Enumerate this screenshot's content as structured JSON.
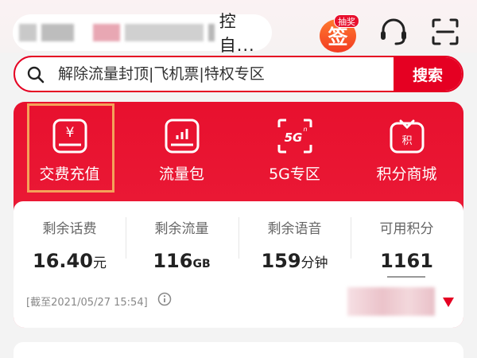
{
  "header": {
    "user_pill_text": "控自...",
    "sign_label": "签",
    "sign_tag": "抽奖",
    "icons": [
      "customer-service-icon",
      "scan-icon"
    ]
  },
  "search": {
    "placeholder": "解除流量封顶|飞机票|特权专区",
    "button_label": "搜索"
  },
  "quick_actions": [
    {
      "label": "交费充值",
      "icon": "yuan-payment-icon",
      "focused": true
    },
    {
      "label": "流量包",
      "icon": "data-package-icon",
      "focused": false
    },
    {
      "label": "5G专区",
      "icon": "5g-icon",
      "focused": false
    },
    {
      "label": "积分商城",
      "icon": "points-mall-icon",
      "focused": false
    }
  ],
  "balance": {
    "items": [
      {
        "label": "剩余话费",
        "value": "16.40",
        "unit": "元"
      },
      {
        "label": "剩余流量",
        "value": "116",
        "unit": "GB"
      },
      {
        "label": "剩余语音",
        "value": "159",
        "unit": "分钟"
      },
      {
        "label": "可用积分",
        "value": "1161",
        "unit": ""
      }
    ],
    "timestamp": "[截至2021/05/27 15:54]"
  },
  "colors": {
    "brand_red": "#e50022",
    "focus_outline": "#f4a25a",
    "sign_orange": "#f23b22"
  }
}
